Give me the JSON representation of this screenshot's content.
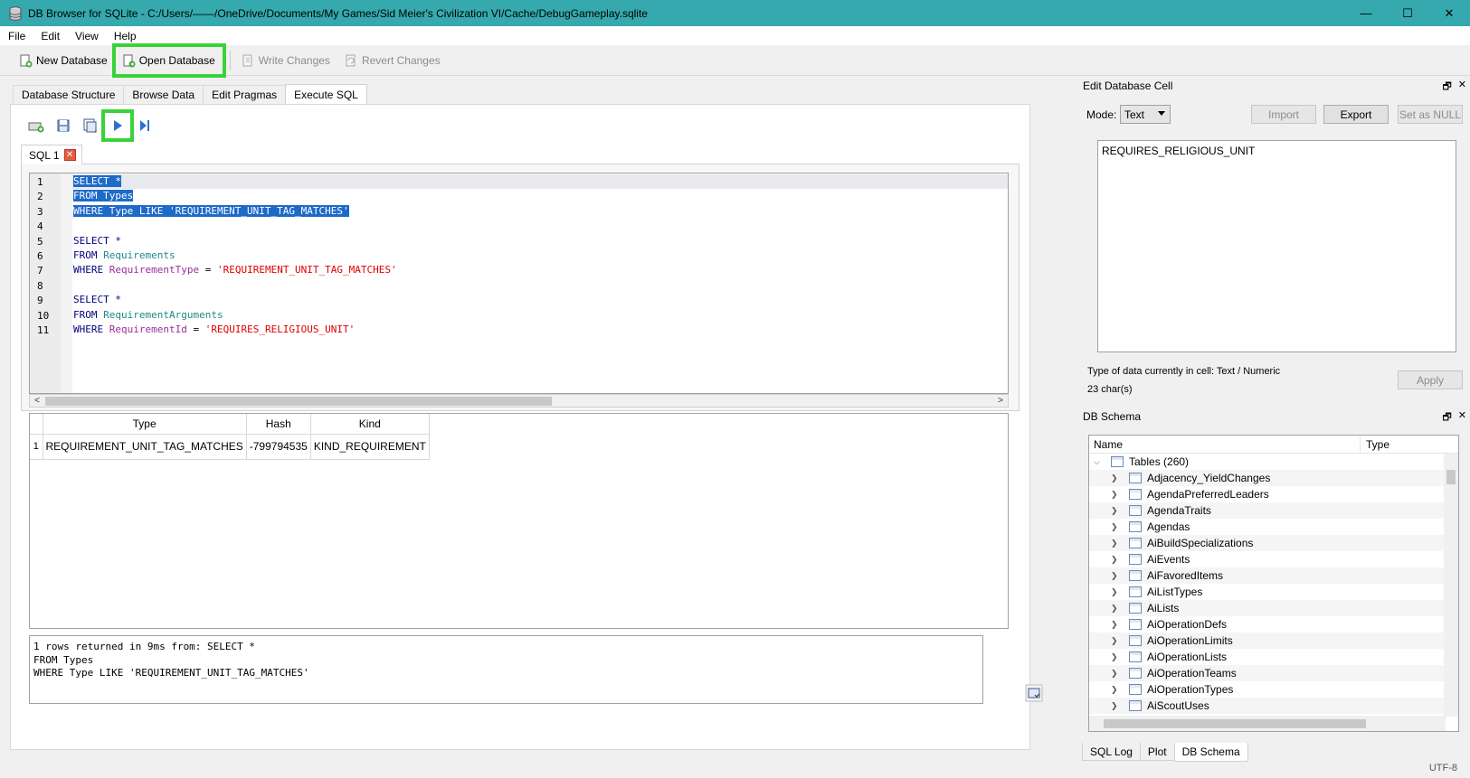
{
  "window": {
    "title": "DB Browser for SQLite - C:/Users/——/OneDrive/Documents/My Games/Sid Meier's Civilization VI/Cache/DebugGameplay.sqlite",
    "minimize": "—",
    "maximize": "☐",
    "close": "✕"
  },
  "menu": [
    "File",
    "Edit",
    "View",
    "Help"
  ],
  "toolbar": {
    "new_db": "New Database",
    "open_db": "Open Database",
    "write_changes": "Write Changes",
    "revert_changes": "Revert Changes"
  },
  "tabs": [
    "Database Structure",
    "Browse Data",
    "Edit Pragmas",
    "Execute SQL"
  ],
  "sql_tab": {
    "label": "SQL 1",
    "close": "✕"
  },
  "editor": {
    "line_numbers": [
      "1",
      "2",
      "3",
      "4",
      "5",
      "6",
      "7",
      "8",
      "9",
      "10",
      "11"
    ],
    "lines": [
      {
        "a": "SELECT *",
        "b": "",
        "c": "",
        "d": "",
        "e": ""
      },
      {
        "a": "FROM Types",
        "b": "",
        "c": "",
        "d": "",
        "e": ""
      },
      {
        "a": "WHERE Type LIKE 'REQUIREMENT_UNIT_TAG_MATCHES'",
        "b": "",
        "c": "",
        "d": "",
        "e": ""
      },
      {
        "a": "",
        "b": "",
        "c": "",
        "d": "",
        "e": ""
      },
      {
        "a": "SELECT *",
        "b": "",
        "c": "",
        "d": "",
        "e": ""
      },
      {
        "a": "FROM ",
        "b": "Requirements",
        "c": "",
        "d": "",
        "e": ""
      },
      {
        "a": "WHERE ",
        "b": "",
        "c": "RequirementType",
        "d": " = ",
        "e": "'REQUIREMENT_UNIT_TAG_MATCHES'"
      },
      {
        "a": "",
        "b": "",
        "c": "",
        "d": "",
        "e": ""
      },
      {
        "a": "SELECT *",
        "b": "",
        "c": "",
        "d": "",
        "e": ""
      },
      {
        "a": "FROM ",
        "b": "RequirementArguments",
        "c": "",
        "d": "",
        "e": ""
      },
      {
        "a": "WHERE ",
        "b": "",
        "c": "RequirementId",
        "d": " = ",
        "e": "'REQUIRES_RELIGIOUS_UNIT'"
      }
    ]
  },
  "results": {
    "columns": [
      "Type",
      "Hash",
      "Kind"
    ],
    "rows": [
      {
        "num": "1",
        "cells": [
          "REQUIREMENT_UNIT_TAG_MATCHES",
          "-799794535",
          "KIND_REQUIREMENT"
        ]
      }
    ]
  },
  "message": "1 rows returned in 9ms from: SELECT *\nFROM Types\nWHERE Type LIKE 'REQUIREMENT_UNIT_TAG_MATCHES'",
  "edit_cell": {
    "title": "Edit Database Cell",
    "mode_label": "Mode:",
    "mode_value": "Text",
    "import": "Import",
    "export": "Export",
    "set_null": "Set as NULL",
    "value": "REQUIRES_RELIGIOUS_UNIT",
    "type_info": "Type of data currently in cell: Text / Numeric",
    "char_count": "23 char(s)",
    "apply": "Apply",
    "dock_btns": [
      "🗗",
      "✕"
    ]
  },
  "schema": {
    "title": "DB Schema",
    "col_name": "Name",
    "col_type": "Type",
    "root": "Tables (260)",
    "tables": [
      "Adjacency_YieldChanges",
      "AgendaPreferredLeaders",
      "AgendaTraits",
      "Agendas",
      "AiBuildSpecializations",
      "AiEvents",
      "AiFavoredItems",
      "AiListTypes",
      "AiLists",
      "AiOperationDefs",
      "AiOperationLimits",
      "AiOperationLists",
      "AiOperationTeams",
      "AiOperationTypes",
      "AiScoutUses"
    ]
  },
  "dock_tabs": [
    "SQL Log",
    "Plot",
    "DB Schema"
  ],
  "status": "UTF-8",
  "colors": {
    "titlebar": "#35a9ad",
    "highlight": "#3ad23a",
    "selection": "#1e6ac9"
  }
}
